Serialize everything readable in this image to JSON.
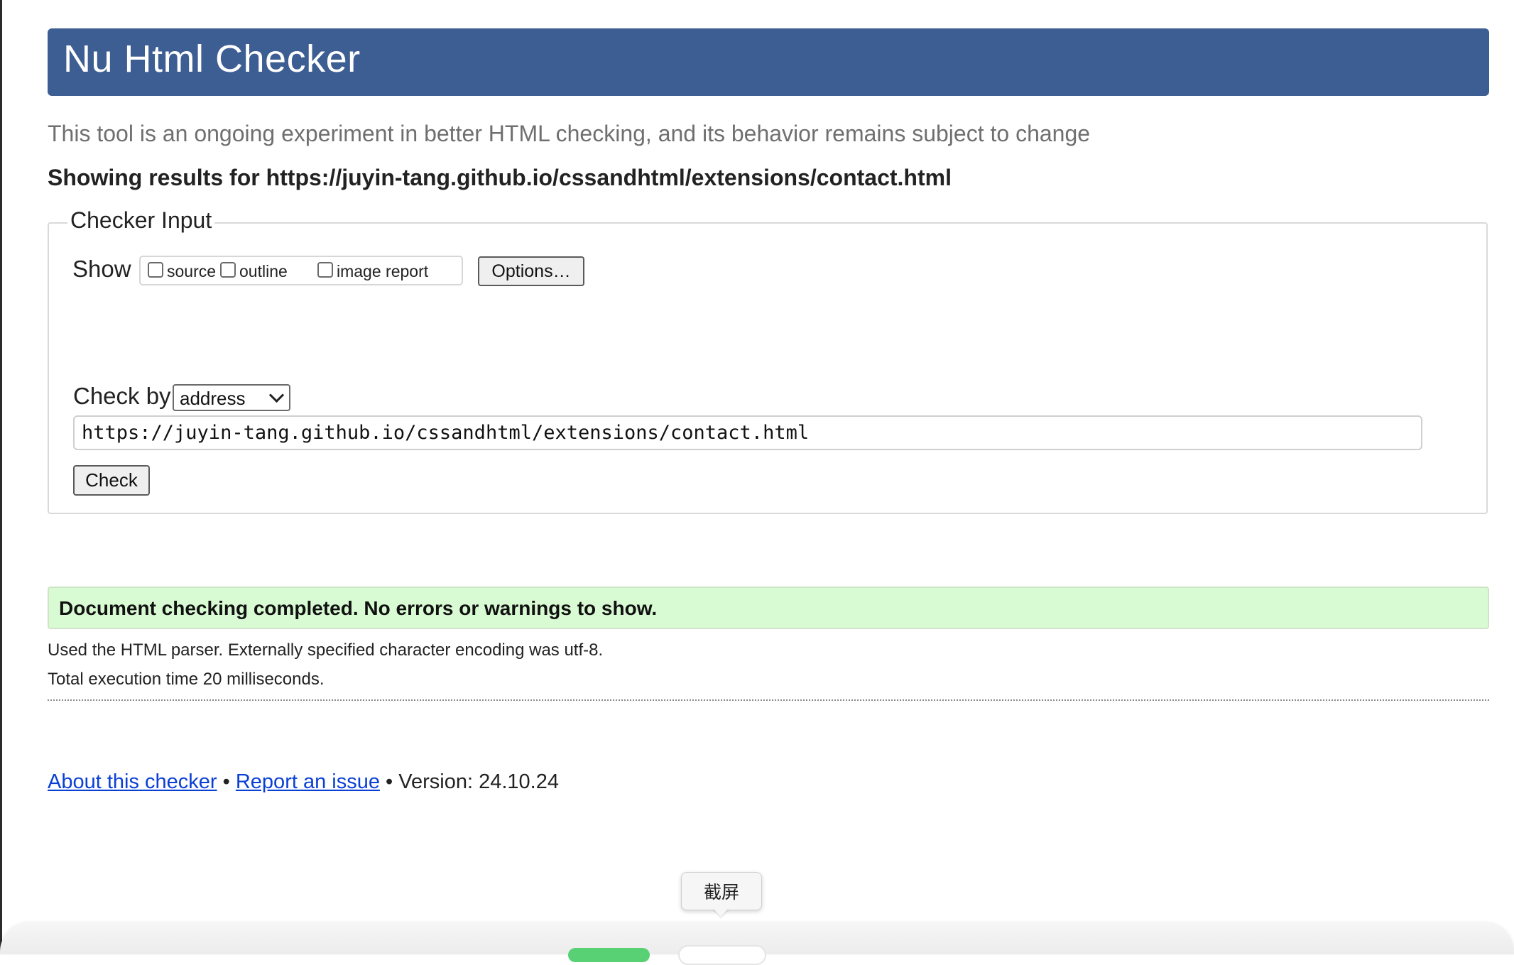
{
  "header": {
    "title": "Nu Html Checker"
  },
  "notice": "This tool is an ongoing experiment in better HTML checking, and its behavior remains subject to change",
  "showing": "Showing results for https://juyin-tang.github.io/cssandhtml/extensions/contact.html",
  "checker_input": {
    "legend": "Checker Input",
    "show_label": "Show",
    "checkboxes": [
      {
        "label": "source",
        "checked": false
      },
      {
        "label": "outline",
        "checked": false
      },
      {
        "label": "image report",
        "checked": false
      }
    ],
    "options_label": "Options…",
    "check_by_label": "Check by",
    "check_by_value": "address",
    "url_value": "https://juyin-tang.github.io/cssandhtml/extensions/contact.html",
    "check_label": "Check"
  },
  "result": {
    "message": "Document checking completed. No errors or warnings to show.",
    "parser_info": "Used the HTML parser. Externally specified character encoding was utf-8.",
    "time_info": "Total execution time 20 milliseconds."
  },
  "footer": {
    "about_link": "About this checker",
    "separator": "•",
    "issue_link": "Report an issue",
    "version": "Version: 24.10.24"
  },
  "overlay": {
    "tooltip": "截屏"
  },
  "colors": {
    "header_bg": "#3d5e93",
    "success_bg": "#d9fbd3",
    "link": "#0a3fd6",
    "dock_green": "#57d173"
  }
}
